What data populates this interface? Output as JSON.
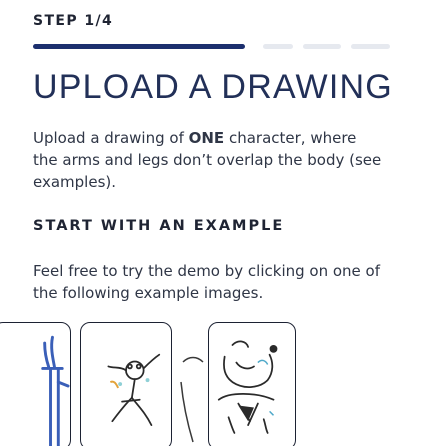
{
  "step": {
    "label": "STEP 1/4",
    "current": 1,
    "total": 4
  },
  "header": {
    "title": "UPLOAD A DRAWING"
  },
  "intro": {
    "before": "Upload a drawing of ",
    "emphasis": "ONE",
    "after": " character, where the arms and legs don’t overlap the body (see examples)."
  },
  "example_section": {
    "title": "START WITH AN EXAMPLE",
    "text": "Feel free to try the demo by clicking on one of the following example images."
  },
  "colors": {
    "accent": "#1c2f6e",
    "title": "#223058",
    "inactive": "#e6e9ef"
  },
  "examples": [
    {
      "icon": "stick-figure-drawing"
    },
    {
      "icon": "dancing-figure-drawing"
    },
    {
      "icon": "bear-drawing"
    },
    {
      "icon": "monster-drawing"
    }
  ]
}
